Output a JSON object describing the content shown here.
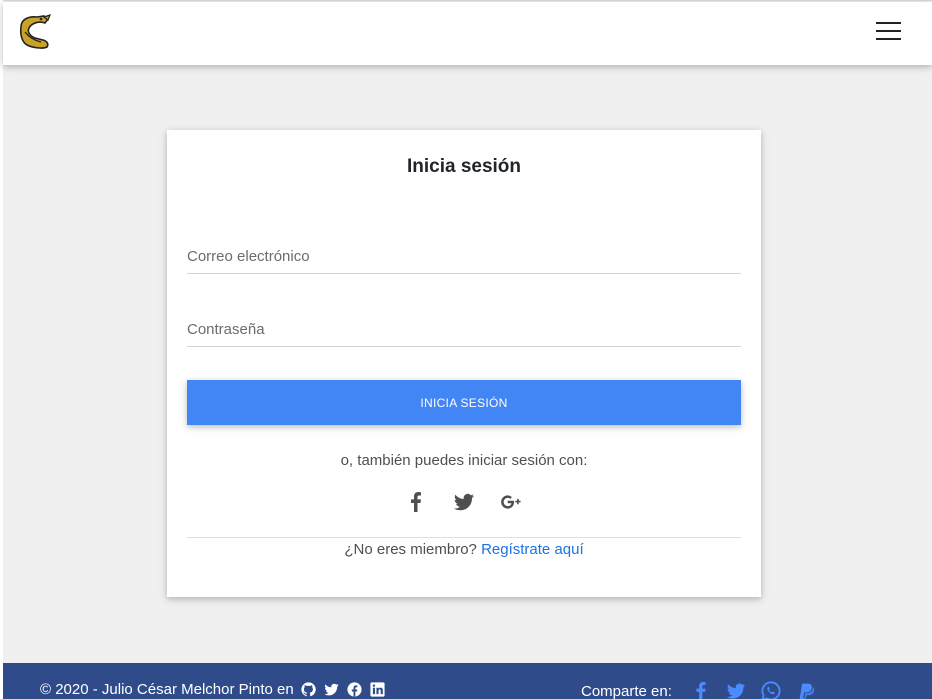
{
  "brand": {
    "logo_icon": "hedgehog-logo-icon",
    "logo_color": "#c9a227"
  },
  "navbar": {
    "menu_icon": "hamburger-menu-icon"
  },
  "login": {
    "title": "Inicia sesión",
    "email_placeholder": "Correo electrónico",
    "email_value": "",
    "password_placeholder": "Contraseña",
    "password_value": "",
    "submit_label": "INICIA SESIÓN",
    "alt_text": "o, también puedes iniciar sesión con:",
    "social": [
      {
        "icon": "facebook-icon"
      },
      {
        "icon": "twitter-icon"
      },
      {
        "icon": "google-plus-icon"
      }
    ],
    "signup_prompt": "¿No eres miembro?",
    "signup_link": "Regístrate aquí",
    "accent": "#4285f4",
    "link_color": "#1a73e8"
  },
  "footer": {
    "copyright": "© 2020 - Julio César Melchor Pinto en",
    "profile_icons": [
      "github-icon",
      "twitter-icon",
      "facebook-icon",
      "linkedin-icon"
    ],
    "share_label": "Comparte en:",
    "share_icons": [
      "facebook-icon",
      "twitter-icon",
      "whatsapp-icon",
      "paypal-icon"
    ],
    "background": "#2f4b8a",
    "share_icon_color": "#4a8cff"
  }
}
